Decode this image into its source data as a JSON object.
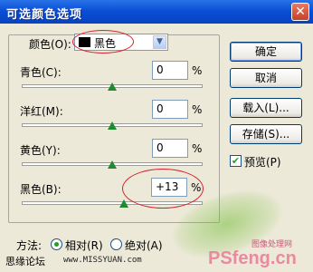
{
  "title": "可选颜色选项",
  "colors": {
    "label": "颜色(O):",
    "selected": "黑色"
  },
  "sliders": [
    {
      "label": "青色(C):",
      "value": "0",
      "unit": "%",
      "level": 0.5
    },
    {
      "label": "洋红(M):",
      "value": "0",
      "unit": "%",
      "level": 0.5
    },
    {
      "label": "黄色(Y):",
      "value": "0",
      "unit": "%",
      "level": 0.5
    },
    {
      "label": "黑色(B):",
      "value": "+13",
      "unit": "%",
      "level": 0.565
    }
  ],
  "buttons": {
    "ok": "确定",
    "cancel": "取消",
    "load": "载入(L)...",
    "save": "存储(S)...",
    "preview": "预览(P)"
  },
  "method": {
    "label": "方法:",
    "relative": "相对(R)",
    "absolute": "绝对(A)"
  },
  "watermarks": {
    "forum": "思缘论坛",
    "url": "www.MISSYUAN.com",
    "ps_logo": "PSfeng.cn",
    "ps_sub": "图像处理网"
  }
}
